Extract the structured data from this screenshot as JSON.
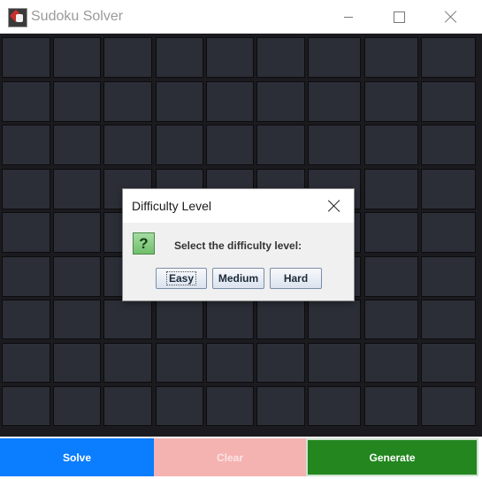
{
  "window": {
    "title": "Sudoku Solver",
    "icon": "sudoku-app-icon",
    "controls": [
      "minimize",
      "maximize",
      "close"
    ]
  },
  "grid": {
    "rows": 9,
    "cols": 9,
    "cell_values": [
      [
        "",
        "",
        "",
        "",
        "",
        "",
        "",
        "",
        ""
      ],
      [
        "",
        "",
        "",
        "",
        "",
        "",
        "",
        "",
        ""
      ],
      [
        "",
        "",
        "",
        "",
        "",
        "",
        "",
        "",
        ""
      ],
      [
        "",
        "",
        "",
        "",
        "",
        "",
        "",
        "",
        ""
      ],
      [
        "",
        "",
        "",
        "",
        "",
        "",
        "",
        "",
        ""
      ],
      [
        "",
        "",
        "",
        "",
        "",
        "",
        "",
        "",
        ""
      ],
      [
        "",
        "",
        "",
        "",
        "",
        "",
        "",
        "",
        ""
      ],
      [
        "",
        "",
        "",
        "",
        "",
        "",
        "",
        "",
        ""
      ],
      [
        "",
        "",
        "",
        "",
        "",
        "",
        "",
        "",
        ""
      ]
    ],
    "cell_color": "#2b2e37",
    "border_color": "#0c0c0e"
  },
  "dialog": {
    "title": "Difficulty Level",
    "icon": "question-icon",
    "message": "Select the difficulty level:",
    "buttons": {
      "easy": "Easy",
      "medium": "Medium",
      "hard": "Hard"
    },
    "selected": "Easy"
  },
  "actions": {
    "solve": "Solve",
    "clear": "Clear",
    "generate": "Generate",
    "colors": {
      "solve": "#0b7dff",
      "clear": "#f4b3b1",
      "generate": "#23861f"
    }
  }
}
